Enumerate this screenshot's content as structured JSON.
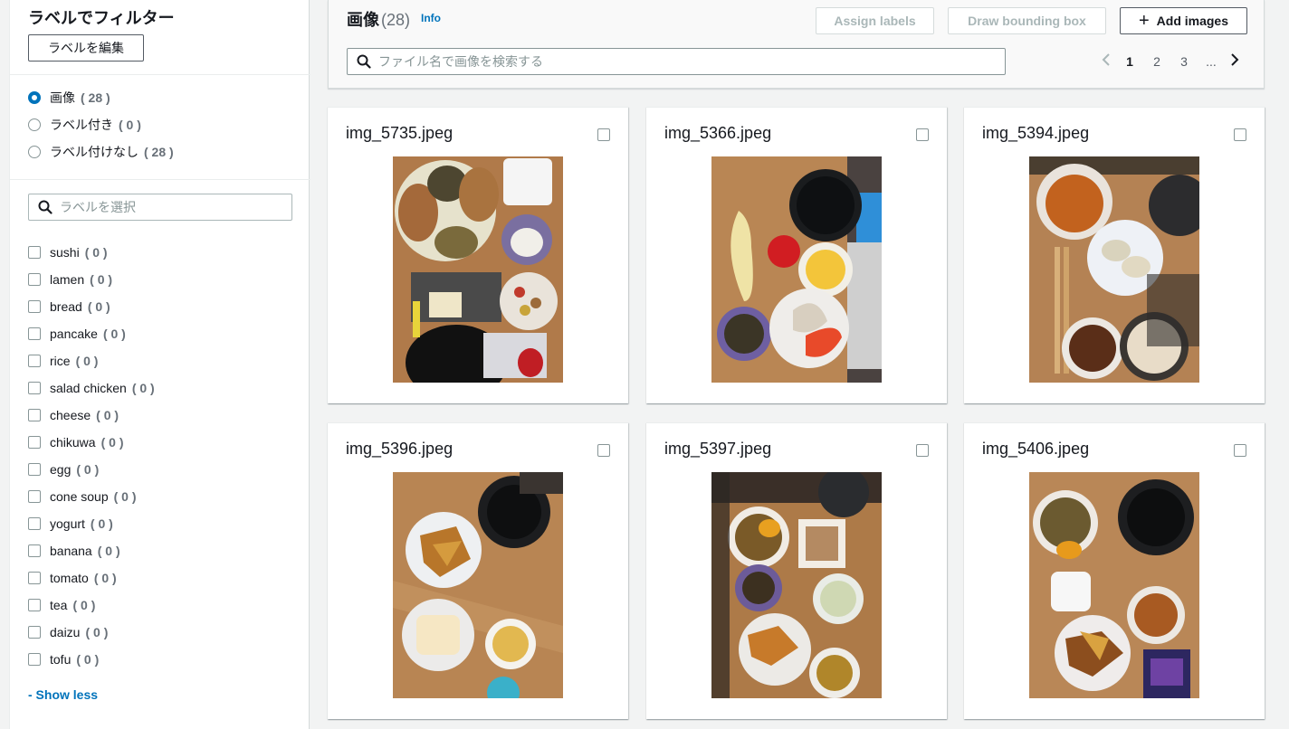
{
  "sidebar": {
    "title": "ラベルでフィルター",
    "edit_labels": "ラベルを編集",
    "radios": [
      {
        "label": "画像",
        "count": "( 28 )",
        "selected": true
      },
      {
        "label": "ラベル付き",
        "count": "( 0 )",
        "selected": false
      },
      {
        "label": "ラベル付けなし",
        "count": "( 28 )",
        "selected": false
      }
    ],
    "label_search_placeholder": "ラベルを選択",
    "labels": [
      {
        "name": "sushi",
        "count": "( 0 )"
      },
      {
        "name": "lamen",
        "count": "( 0 )"
      },
      {
        "name": "bread",
        "count": "( 0 )"
      },
      {
        "name": "pancake",
        "count": "( 0 )"
      },
      {
        "name": "rice",
        "count": "( 0 )"
      },
      {
        "name": "salad chicken",
        "count": "( 0 )"
      },
      {
        "name": "cheese",
        "count": "( 0 )"
      },
      {
        "name": "chikuwa",
        "count": "( 0 )"
      },
      {
        "name": "egg",
        "count": "( 0 )"
      },
      {
        "name": "cone soup",
        "count": "( 0 )"
      },
      {
        "name": "yogurt",
        "count": "( 0 )"
      },
      {
        "name": "banana",
        "count": "( 0 )"
      },
      {
        "name": "tomato",
        "count": "( 0 )"
      },
      {
        "name": "tea",
        "count": "( 0 )"
      },
      {
        "name": "daizu",
        "count": "( 0 )"
      },
      {
        "name": "tofu",
        "count": "( 0 )"
      }
    ],
    "show_less": "- Show less"
  },
  "header": {
    "title": "画像",
    "count": "(28)",
    "info": "Info",
    "assign_labels": "Assign labels",
    "draw_bounding_box": "Draw bounding box",
    "add_images": "Add images",
    "search_placeholder": "ファイル名で画像を検索する",
    "pages": [
      "1",
      "2",
      "3",
      "..."
    ]
  },
  "images": [
    {
      "name": "img_5735.jpeg"
    },
    {
      "name": "img_5366.jpeg"
    },
    {
      "name": "img_5394.jpeg"
    },
    {
      "name": "img_5396.jpeg"
    },
    {
      "name": "img_5397.jpeg"
    },
    {
      "name": "img_5406.jpeg"
    }
  ],
  "colors": {
    "accent": "#0073bb",
    "tray": "#b78556",
    "plate": "#f0ece4"
  }
}
